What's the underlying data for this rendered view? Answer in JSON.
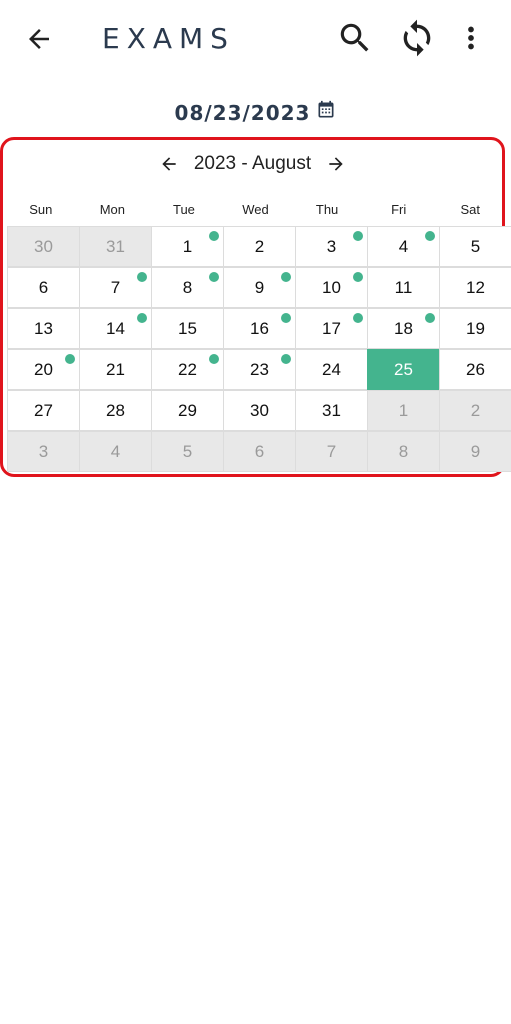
{
  "app": {
    "title": "EXAMS"
  },
  "icons": {
    "back": "arrow-left-icon",
    "search": "search-icon",
    "refresh": "refresh-icon",
    "menu": "more-vert-icon",
    "calendar": "calendar-icon"
  },
  "selected_date": "08/23/2023",
  "calendar": {
    "title": "2023 - August",
    "weekdays": [
      "Sun",
      "Mon",
      "Tue",
      "Wed",
      "Thu",
      "Fri",
      "Sat"
    ],
    "today_color": "#44b48e",
    "highlight_border_color": "#e0141c",
    "weeks": [
      [
        {
          "day": "30",
          "other": true
        },
        {
          "day": "31",
          "other": true
        },
        {
          "day": "1",
          "dot": true
        },
        {
          "day": "2"
        },
        {
          "day": "3",
          "dot": true
        },
        {
          "day": "4",
          "dot": true
        },
        {
          "day": "5"
        }
      ],
      [
        {
          "day": "6"
        },
        {
          "day": "7",
          "dot": true
        },
        {
          "day": "8",
          "dot": true
        },
        {
          "day": "9",
          "dot": true
        },
        {
          "day": "10",
          "dot": true
        },
        {
          "day": "11"
        },
        {
          "day": "12"
        }
      ],
      [
        {
          "day": "13"
        },
        {
          "day": "14",
          "dot": true
        },
        {
          "day": "15"
        },
        {
          "day": "16",
          "dot": true
        },
        {
          "day": "17",
          "dot": true
        },
        {
          "day": "18",
          "dot": true
        },
        {
          "day": "19"
        }
      ],
      [
        {
          "day": "20",
          "dot": true
        },
        {
          "day": "21"
        },
        {
          "day": "22",
          "dot": true
        },
        {
          "day": "23",
          "dot": true
        },
        {
          "day": "24"
        },
        {
          "day": "25",
          "today": true
        },
        {
          "day": "26"
        }
      ],
      [
        {
          "day": "27"
        },
        {
          "day": "28"
        },
        {
          "day": "29"
        },
        {
          "day": "30"
        },
        {
          "day": "31"
        },
        {
          "day": "1",
          "other": true
        },
        {
          "day": "2",
          "other": true
        }
      ],
      [
        {
          "day": "3",
          "other": true
        },
        {
          "day": "4",
          "other": true
        },
        {
          "day": "5",
          "other": true
        },
        {
          "day": "6",
          "other": true
        },
        {
          "day": "7",
          "other": true
        },
        {
          "day": "8",
          "other": true
        },
        {
          "day": "9",
          "other": true
        }
      ]
    ]
  }
}
